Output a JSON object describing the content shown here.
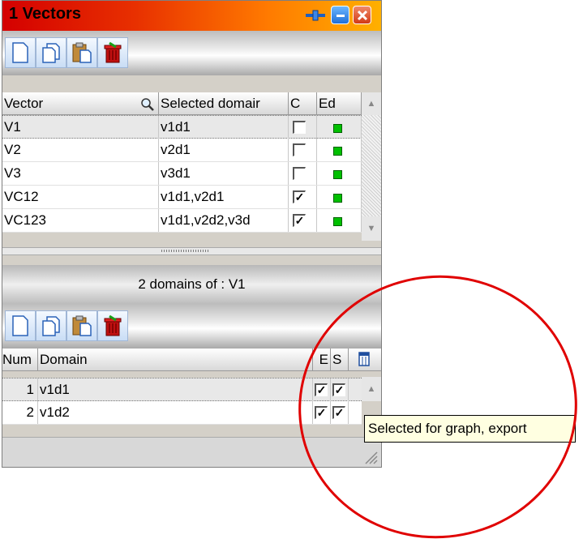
{
  "window": {
    "title": "1  Vectors"
  },
  "toolbar_icons": [
    "new-document-icon",
    "copy-icon",
    "paste-icon",
    "delete-icon"
  ],
  "vectors": {
    "columns": {
      "vector": "Vector",
      "domain": "Selected domair",
      "c": "C",
      "ed": "Ed"
    },
    "rows": [
      {
        "name": "V1",
        "domain": "v1d1",
        "checked": false,
        "ed": true
      },
      {
        "name": "V2",
        "domain": "v2d1",
        "checked": false,
        "ed": true
      },
      {
        "name": "V3",
        "domain": "v3d1",
        "checked": false,
        "ed": true
      },
      {
        "name": "VC12",
        "domain": "v1d1,v2d1",
        "checked": true,
        "ed": true
      },
      {
        "name": "VC123",
        "domain": "v1d1,v2d2,v3d",
        "checked": true,
        "ed": true
      }
    ]
  },
  "subheader": "2 domains of : V1",
  "domains": {
    "columns": {
      "num": "Num",
      "domain": "Domain",
      "e": "E",
      "s": "S"
    },
    "rows": [
      {
        "num": "1",
        "domain": "v1d1",
        "e": true,
        "s": true
      },
      {
        "num": "2",
        "domain": "v1d2",
        "e": true,
        "s": true
      }
    ]
  },
  "tooltip": "Selected for graph, export",
  "colors": {
    "title_start": "#d40000",
    "title_end": "#ffb000",
    "annotation": "#e00000",
    "indicator": "#00c000"
  }
}
